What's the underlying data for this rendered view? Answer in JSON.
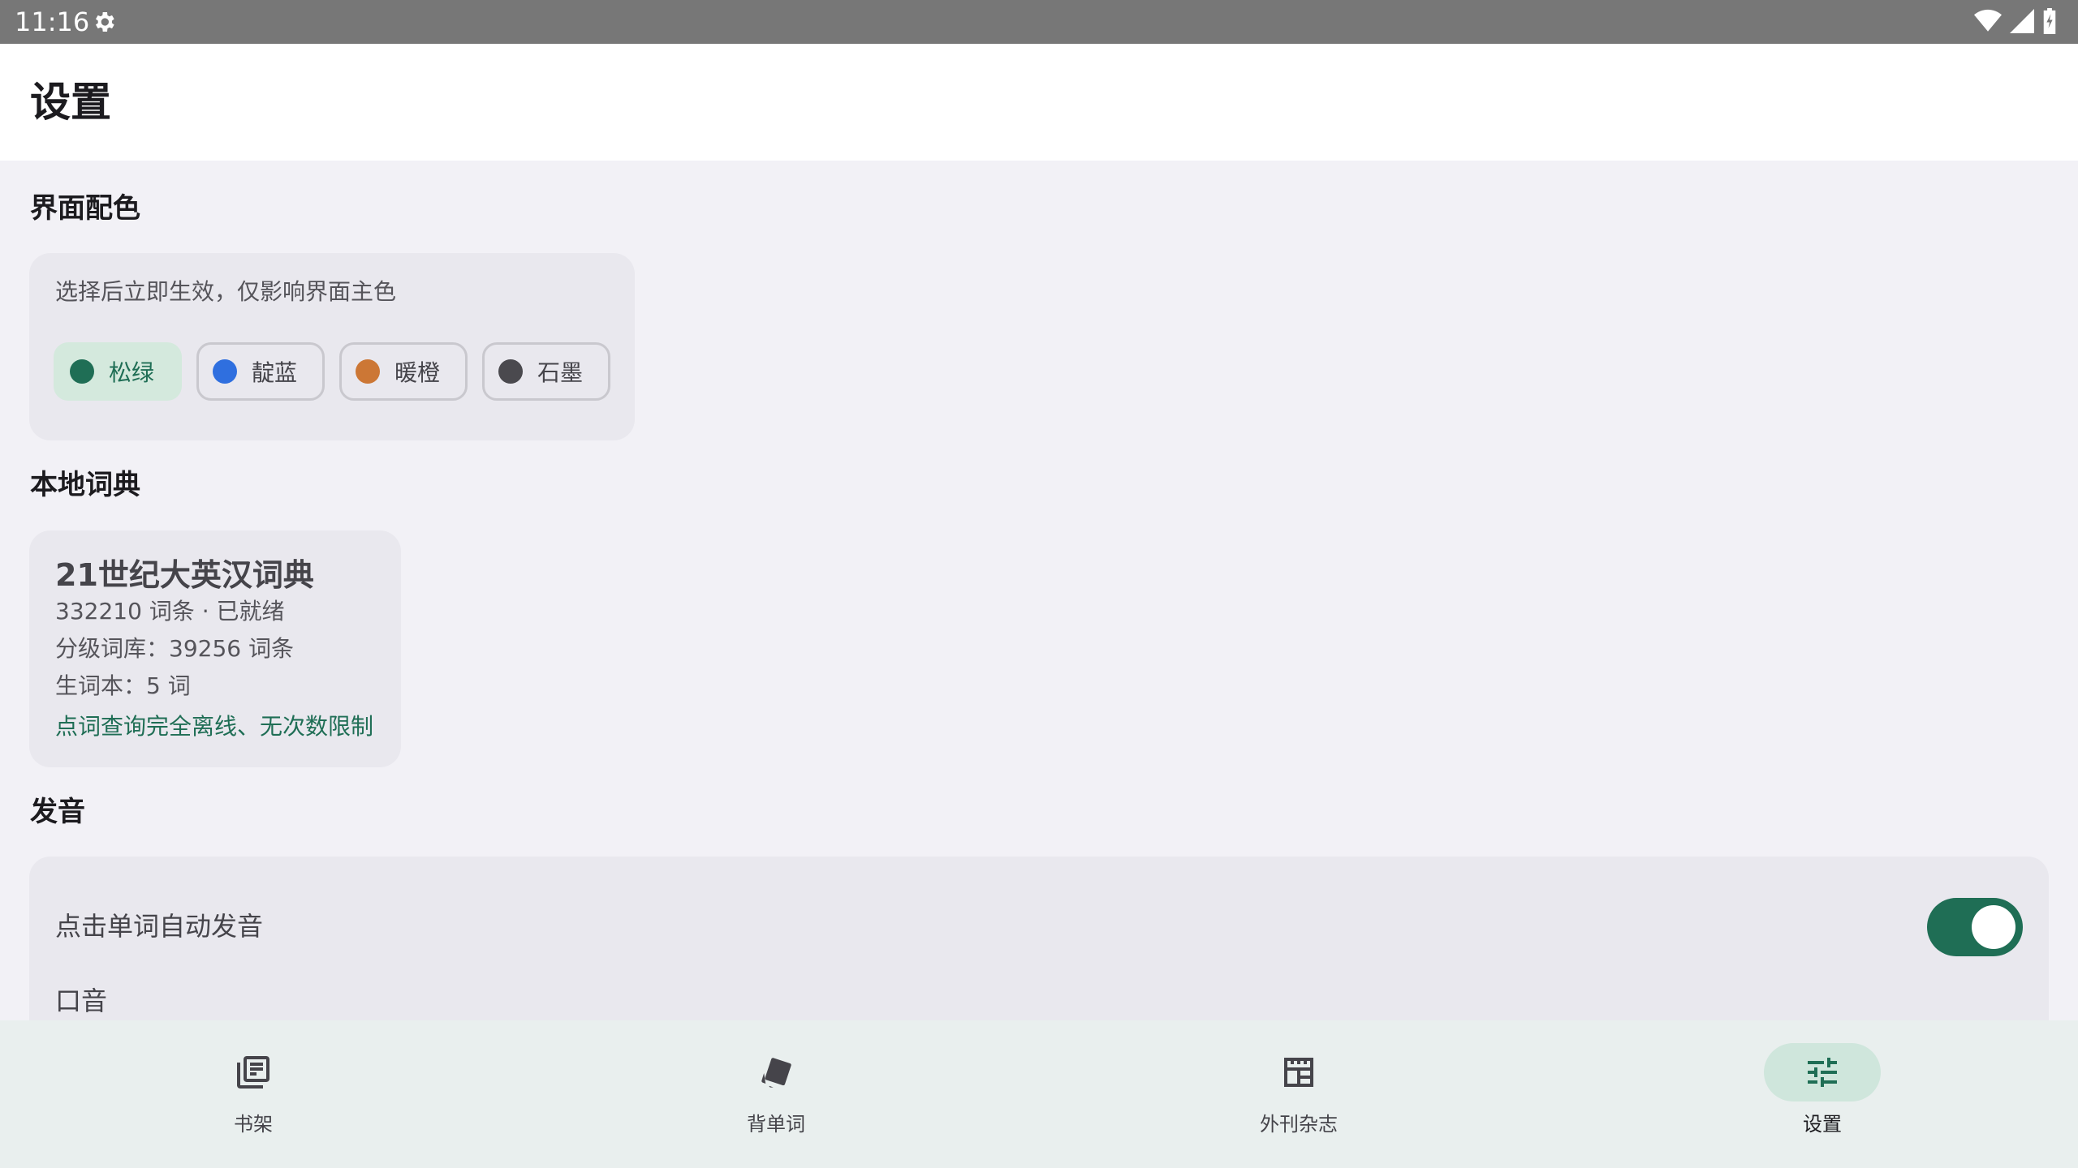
{
  "status_bar": {
    "time": "11:16"
  },
  "page": {
    "title": "设置"
  },
  "theme_section": {
    "title": "界面配色",
    "description": "选择后立即生效，仅影响界面主色",
    "options": [
      {
        "label": "松绿",
        "color": "#1f6e55",
        "selected": true
      },
      {
        "label": "靛蓝",
        "color": "#2f6fdf",
        "selected": false
      },
      {
        "label": "暖橙",
        "color": "#cc7735",
        "selected": false
      },
      {
        "label": "石墨",
        "color": "#4a494e",
        "selected": false
      }
    ]
  },
  "dictionary_section": {
    "title": "本地词典",
    "name": "21世纪大英汉词典",
    "entries": "332210 词条 · 已就绪",
    "graded": "分级词库：39256 词条",
    "vocab": "生词本：5 词",
    "note": "点词查询完全离线、无次数限制"
  },
  "pronunciation_section": {
    "title": "发音",
    "auto_play_label": "点击单词自动发音",
    "auto_play_enabled": true,
    "accent_label": "口音"
  },
  "bottom_nav": {
    "items": [
      {
        "label": "书架",
        "icon": "bookshelf-icon",
        "active": false
      },
      {
        "label": "背单词",
        "icon": "flashcards-icon",
        "active": false
      },
      {
        "label": "外刊杂志",
        "icon": "magazine-icon",
        "active": false
      },
      {
        "label": "设置",
        "icon": "settings-sliders-icon",
        "active": true
      }
    ]
  },
  "colors": {
    "accent": "#1f6e55",
    "status_bar": "#777777",
    "background": "#f2f1f6",
    "card": "#e9e8ee"
  }
}
